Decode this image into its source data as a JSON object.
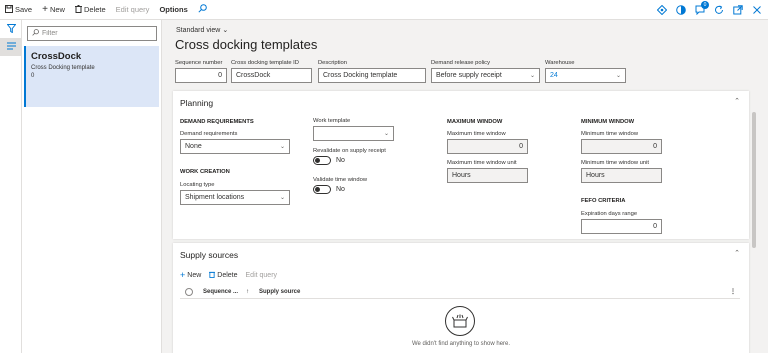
{
  "toolbar": {
    "save": "Save",
    "new": "New",
    "delete": "Delete",
    "edit_query": "Edit query",
    "options": "Options",
    "notification_count": "0"
  },
  "list": {
    "filter_placeholder": "Filter",
    "items": [
      {
        "title": "CrossDock",
        "subtitle": "Cross Docking template",
        "sequence": "0"
      }
    ]
  },
  "header": {
    "view": "Standard view",
    "title": "Cross docking templates",
    "fields": {
      "sequence_number": {
        "label": "Sequence number",
        "value": "0"
      },
      "template_id": {
        "label": "Cross docking template ID",
        "value": "CrossDock"
      },
      "description": {
        "label": "Description",
        "value": "Cross Docking template"
      },
      "demand_release_policy": {
        "label": "Demand release policy",
        "value": "Before supply receipt"
      },
      "warehouse": {
        "label": "Warehouse",
        "value": "24"
      }
    }
  },
  "planning": {
    "title": "Planning",
    "demand_requirements_section": "DEMAND REQUIREMENTS",
    "demand_requirements_label": "Demand requirements",
    "demand_requirements_value": "None",
    "work_creation_section": "WORK CREATION",
    "locating_type_label": "Locating type",
    "locating_type_value": "Shipment locations",
    "work_template_label": "Work template",
    "work_template_value": "",
    "revalidate_label": "Revalidate on supply receipt",
    "revalidate_value": "No",
    "validate_window_label": "Validate time window",
    "validate_window_value": "No",
    "max_window_section": "MAXIMUM WINDOW",
    "max_time_window_label": "Maximum time window",
    "max_time_window_value": "0",
    "max_unit_label": "Maximum time window unit",
    "max_unit_value": "Hours",
    "min_window_section": "MINIMUM WINDOW",
    "min_time_window_label": "Minimum time window",
    "min_time_window_value": "0",
    "min_unit_label": "Minimum time window unit",
    "min_unit_value": "Hours",
    "fefo_section": "FEFO CRITERIA",
    "expiration_label": "Expiration days range",
    "expiration_value": "0"
  },
  "supply_sources": {
    "title": "Supply sources",
    "new": "New",
    "delete": "Delete",
    "edit_query": "Edit query",
    "col_sequence": "Sequence ...",
    "sort_arrow": "↑",
    "col_supply_source": "Supply source",
    "empty_text": "We didn't find anything to show here."
  },
  "colors": {
    "accent": "#0078d4",
    "selected_bg": "#dce6f7",
    "page_bg": "#f3f2f1"
  },
  "icons": [
    "save-icon",
    "add-icon",
    "delete-icon",
    "edit-query-icon",
    "search-icon",
    "diamond-icon",
    "office-icon",
    "chat-icon",
    "refresh-icon",
    "popout-icon",
    "close-icon",
    "filter-icon",
    "list-icon",
    "empty-box-icon"
  ]
}
